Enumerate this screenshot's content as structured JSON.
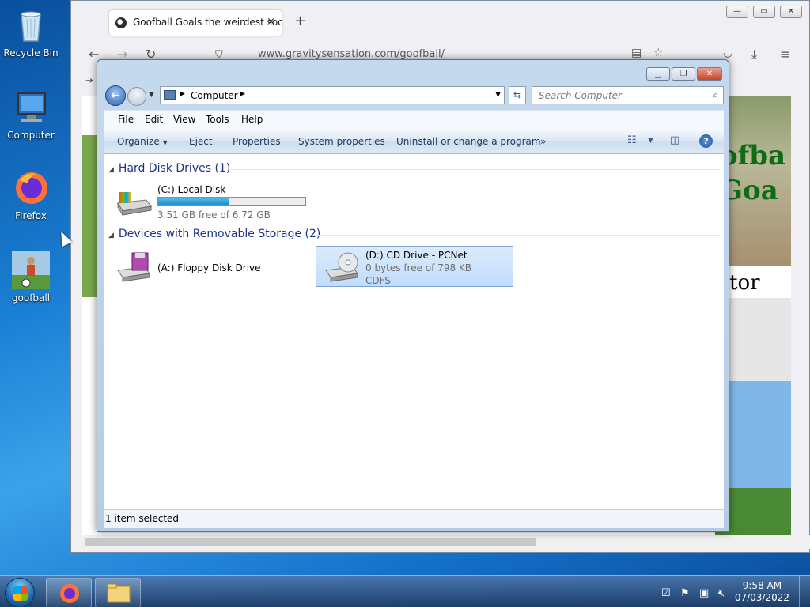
{
  "desktop": {
    "icons": [
      {
        "label": "Recycle Bin"
      },
      {
        "label": "Computer"
      },
      {
        "label": "Firefox"
      },
      {
        "label": "goofball"
      }
    ]
  },
  "firefox": {
    "tab_title": "Goofball Goals the weirdest soc",
    "tab_close": "×",
    "new_tab": "+",
    "url": "www.gravitysensation.com/goofball/",
    "page_banner_text_1": "ofba",
    "page_banner_text_2": "Goa",
    "page_heading_fragment": "tor"
  },
  "explorer": {
    "address": {
      "location": "Computer"
    },
    "search": {
      "placeholder": "Search Computer"
    },
    "menu": [
      "File",
      "Edit",
      "View",
      "Tools",
      "Help"
    ],
    "commands": [
      "Organize",
      "Eject",
      "Properties",
      "System properties",
      "Uninstall or change a program",
      "»"
    ],
    "groups": [
      {
        "title": "Hard Disk Drives (1)",
        "drives": [
          {
            "name": "(C:) Local Disk",
            "free": "3.51 GB free of 6.72 GB",
            "used_fraction": 0.48,
            "icon": "hard-disk-icon"
          }
        ]
      },
      {
        "title": "Devices with Removable Storage (2)",
        "drives": [
          {
            "name": "(A:) Floppy Disk Drive",
            "icon": "floppy-drive-icon"
          },
          {
            "name": "(D:) CD Drive - PCNet",
            "free": "0 bytes free of 798 KB",
            "fs": "CDFS",
            "icon": "cd-drive-icon",
            "selected": true
          }
        ]
      }
    ],
    "status": "1 item selected"
  },
  "taskbar": {
    "time": "9:58 AM",
    "date": "07/03/2022"
  }
}
